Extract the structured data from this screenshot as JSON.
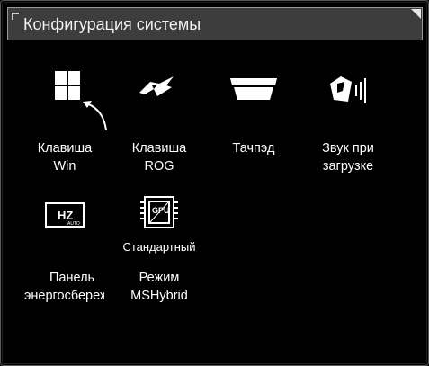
{
  "header": {
    "title": "Конфигурация системы"
  },
  "tiles": [
    {
      "label": "Клавиша\nWin",
      "icon": "windows-icon"
    },
    {
      "label": "Клавиша\nROG",
      "icon": "rog-logo-icon"
    },
    {
      "label": "Тачпэд",
      "icon": "touchpad-icon"
    },
    {
      "label": "Звук при\nзагрузке",
      "icon": "boot-sound-icon"
    },
    {
      "label_line1": "Панель",
      "label_line2": "энергосбережения",
      "icon": "panel-hz-auto-icon"
    },
    {
      "label": "Режим\nMSHybrid",
      "sublabel": "Стандартный",
      "icon": "gpu-icon"
    }
  ],
  "icon_text": {
    "hz": "HZ",
    "auto": "AUTO",
    "gpu": "GPU"
  },
  "colors": {
    "background": "#000000",
    "header": "#3d3d3d",
    "text": "#ffffff"
  }
}
